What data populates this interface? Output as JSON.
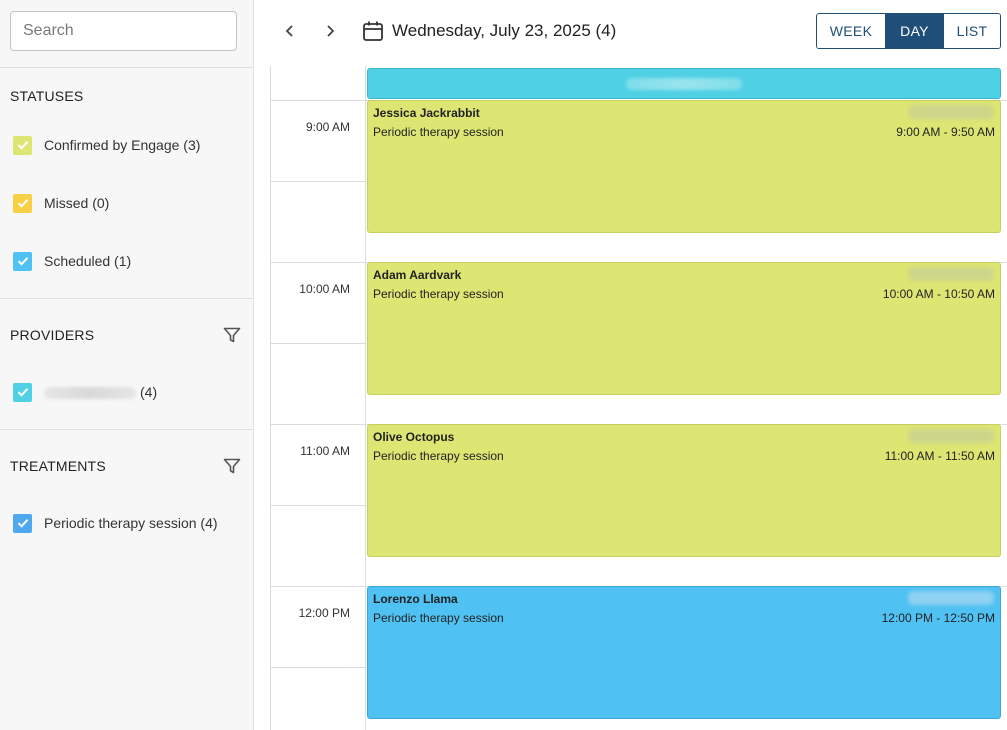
{
  "colors": {
    "accent": "#1f4f78",
    "confirmed": "#dde673",
    "missed": "#f7d046",
    "scheduled": "#4fc1f3",
    "allday": "#4fd0e4"
  },
  "sidebar": {
    "search": {
      "placeholder": "Search",
      "value": ""
    },
    "statuses": {
      "title": "STATUSES",
      "items": [
        {
          "label": "Confirmed by Engage (3)",
          "checked": true,
          "color": "#dde673"
        },
        {
          "label": "Missed (0)",
          "checked": true,
          "color": "#f7d046"
        },
        {
          "label": "Scheduled (1)",
          "checked": true,
          "color": "#4fc1f3"
        }
      ]
    },
    "providers": {
      "title": "PROVIDERS",
      "items": [
        {
          "label": "(4)",
          "checked": true,
          "color": "#4fd0e4",
          "name_redacted": true
        }
      ]
    },
    "treatments": {
      "title": "TREATMENTS",
      "items": [
        {
          "label": "Periodic therapy session (4)",
          "checked": true,
          "color": "#4fa8f0"
        }
      ]
    }
  },
  "header": {
    "date_title": "Wednesday, July 23, 2025 (4)",
    "views": [
      {
        "label": "WEEK",
        "active": false
      },
      {
        "label": "DAY",
        "active": true
      },
      {
        "label": "LIST",
        "active": false
      }
    ]
  },
  "calendar": {
    "times": [
      "9:00 AM",
      "10:00 AM",
      "11:00 AM",
      "12:00 PM"
    ],
    "events": [
      {
        "name": "Jessica Jackrabbit",
        "treatment": "Periodic therapy session",
        "time": "9:00 AM - 9:50 AM",
        "status": "confirmed"
      },
      {
        "name": "Adam Aardvark",
        "treatment": "Periodic therapy session",
        "time": "10:00 AM - 10:50 AM",
        "status": "confirmed"
      },
      {
        "name": "Olive Octopus",
        "treatment": "Periodic therapy session",
        "time": "11:00 AM - 11:50 AM",
        "status": "confirmed"
      },
      {
        "name": "Lorenzo Llama",
        "treatment": "Periodic therapy session",
        "time": "12:00 PM - 12:50 PM",
        "status": "scheduled"
      }
    ]
  }
}
